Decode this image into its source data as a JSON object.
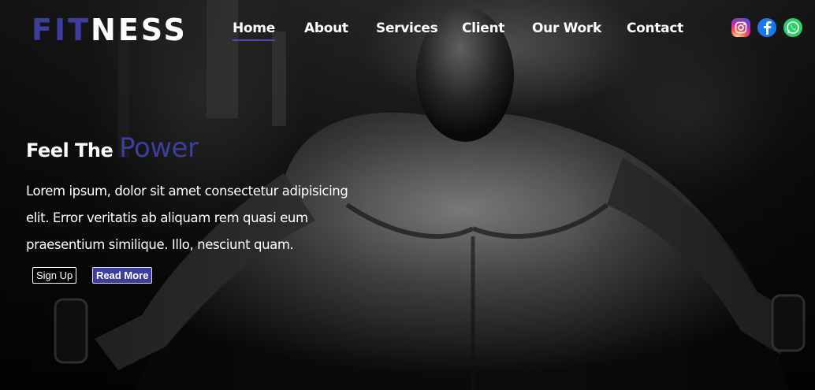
{
  "logo": {
    "accent": "FIT",
    "rest": "NESS"
  },
  "nav": {
    "items": [
      {
        "label": "Home",
        "active": true
      },
      {
        "label": "About"
      },
      {
        "label": "Services"
      },
      {
        "label": "Client"
      },
      {
        "label": "Our Work"
      },
      {
        "label": "Contact"
      }
    ]
  },
  "social": [
    "instagram-icon",
    "facebook-icon",
    "whatsapp-icon"
  ],
  "hero": {
    "headline_part1": "Feel The ",
    "headline_part2": "Power",
    "paragraph": "Lorem ipsum, dolor sit amet consectetur adipisicing elit. Error veritatis ab aliquam rem quasi eum praesentium similique. Illo, nesciunt quam.",
    "signup_label": "Sign Up",
    "readmore_label": "Read More"
  },
  "colors": {
    "accent": "#3d3d9e",
    "nav_underline": "#4a4ab0"
  }
}
